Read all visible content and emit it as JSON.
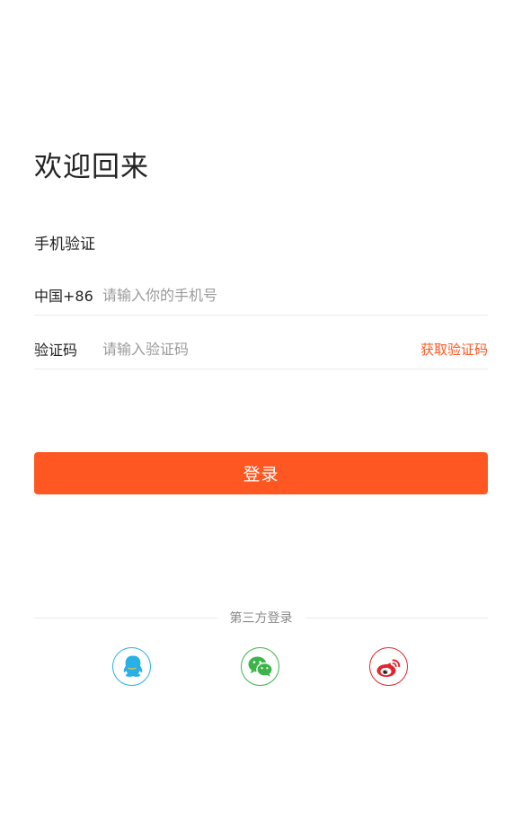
{
  "login": {
    "title": "欢迎回来",
    "subtitle": "手机验证",
    "phone": {
      "prefix": "中国+86",
      "placeholder": "请输入你的手机号",
      "value": ""
    },
    "code": {
      "prefix": "验证码",
      "placeholder": "请输入验证码",
      "value": "",
      "get_code_label": "获取验证码"
    },
    "login_button_label": "登录",
    "third_party": {
      "label": "第三方登录",
      "providers": [
        {
          "name": "qq-icon",
          "color": "#29b0e6"
        },
        {
          "name": "wechat-icon",
          "color": "#3cb449"
        },
        {
          "name": "weibo-icon",
          "color": "#e2252f"
        }
      ]
    }
  },
  "colors": {
    "accent": "#ff5722",
    "placeholder": "#9a9a9a",
    "divider": "#ebebeb"
  }
}
